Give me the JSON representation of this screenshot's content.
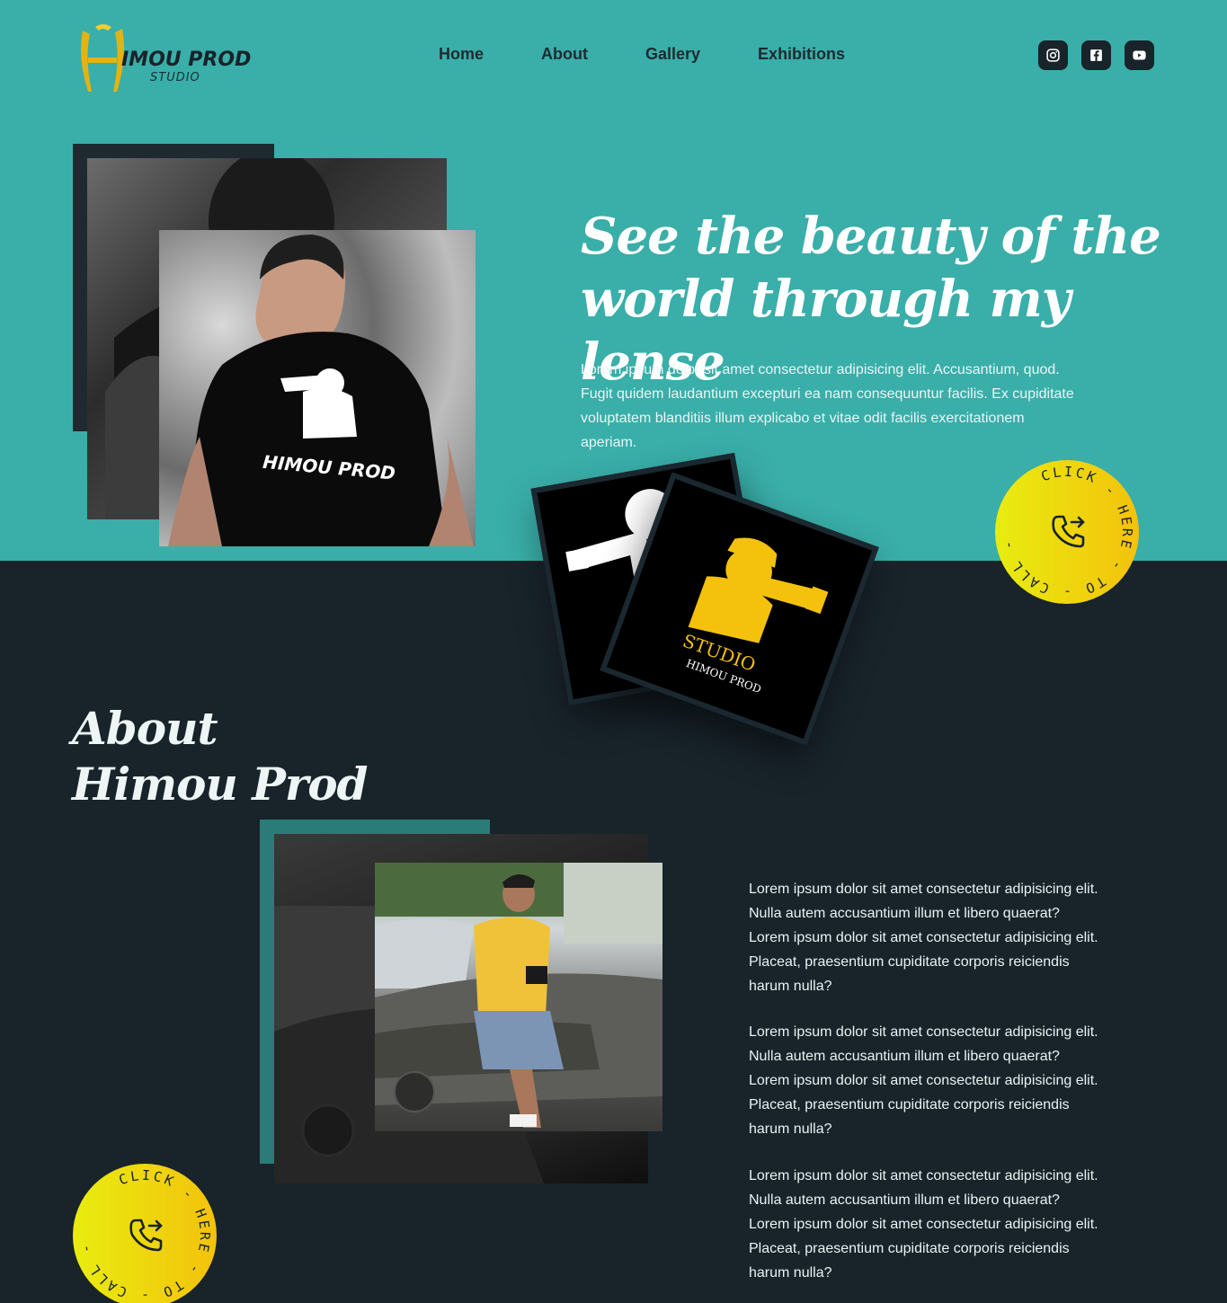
{
  "header": {
    "logo_text": "IMOU PROD",
    "logo_sub": "STUDIO",
    "nav": [
      "Home",
      "About",
      "Gallery",
      "Exhibitions"
    ],
    "social": [
      "instagram-icon",
      "facebook-icon",
      "youtube-icon"
    ]
  },
  "hero": {
    "title": "See the beauty of the world through my lense",
    "text": "Lorem ipsum dolor sit amet consectetur adipisicing elit. Accusantium, quod. Fugit quidem laudantium excepturi ea nam consequuntur facilis. Ex cupiditate voluptatem blanditiis illum explicabo et vitae odit facilis exercitationem aperiam.",
    "shirt_text": "HIMOU PROD",
    "card_text_1": "STUDIO",
    "card_text_2": "HIMOU PROD"
  },
  "call_button": {
    "ring_text": "CLICK - HERE - TO - CALL - ME -"
  },
  "about": {
    "title_line1": "About",
    "title_line2": "Himou Prod",
    "paragraphs": [
      "Lorem ipsum dolor sit amet consectetur adipisicing elit. Nulla autem accusantium illum et libero quaerat? Lorem ipsum dolor sit amet consectetur adipisicing elit. Placeat, praesentium cupiditate corporis reiciendis harum nulla?",
      "Lorem ipsum dolor sit amet consectetur adipisicing elit. Nulla autem accusantium illum et libero quaerat? Lorem ipsum dolor sit amet consectetur adipisicing elit. Placeat, praesentium cupiditate corporis reiciendis harum nulla?",
      "Lorem ipsum dolor sit amet consectetur adipisicing elit. Nulla autem accusantium illum et libero quaerat? Lorem ipsum dolor sit amet consectetur adipisicing elit. Placeat, praesentium cupiditate corporis reiciendis harum nulla?"
    ]
  },
  "colors": {
    "teal": "#3aaea9",
    "dark": "#18232a",
    "yellow": "#f4c20c"
  }
}
